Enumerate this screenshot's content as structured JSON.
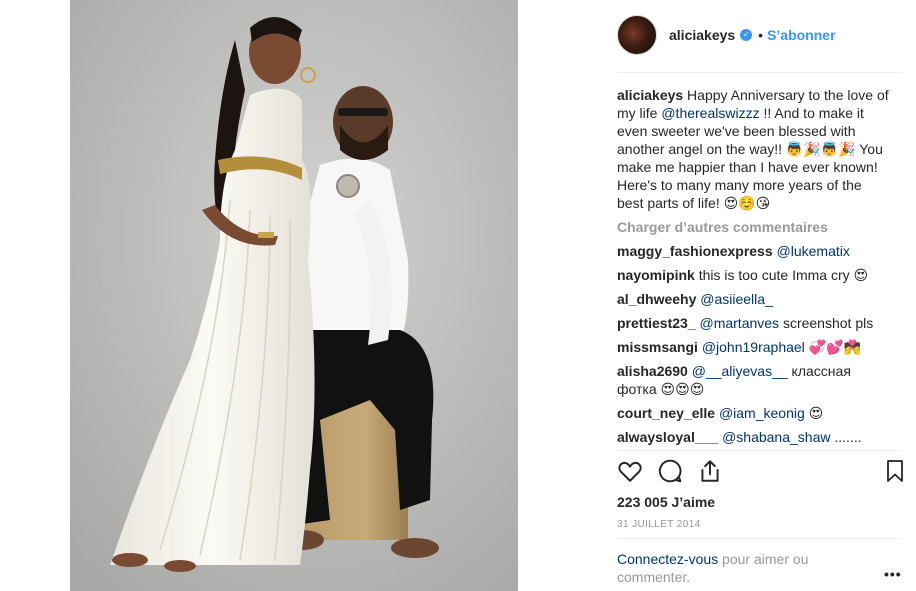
{
  "post": {
    "author": "aliciakeys",
    "follow_label": "S’abonner",
    "separator": "•",
    "verified_icon": "check-icon"
  },
  "caption": {
    "author": "aliciakeys",
    "text_1": " Happy Anniversary to the love of my life ",
    "mention": "@therealswizzz",
    "text_2": " !! And to make it even sweeter we've been blessed with another angel on the way!! 👼🎉👼🎉 You make me happier than I have ever known! Here's to many many more years of the best parts of life! 😍☺️😘"
  },
  "load_more_label": "Charger d’autres commentaires",
  "comments": [
    {
      "user": "maggy_fashionexpress",
      "mention": "@lukematix",
      "text": ""
    },
    {
      "user": "nayomipink",
      "mention": "",
      "text": "this is too cute Imma cry 😍"
    },
    {
      "user": "al_dhweehy",
      "mention": "@asiieella_",
      "text": ""
    },
    {
      "user": "prettiest23_",
      "mention": "@martanves",
      "text": " screenshot pls"
    },
    {
      "user": "missmsangi",
      "mention": "@john19raphael",
      "text": " 💞💕💏"
    },
    {
      "user": "alisha2690",
      "mention": "@__aliyevas__",
      "text": " классная фотка 😍😍😍"
    },
    {
      "user": "court_ney_elle",
      "mention": "@iam_keonig",
      "text": " 😍"
    },
    {
      "user": "alwaysloyal___",
      "mention": "@shabana_shaw",
      "text": " ......."
    }
  ],
  "stats": {
    "likes": "223 005 J’aime",
    "date": "31 JUILLET 2014"
  },
  "login_prompt": {
    "link": "Connectez-vous",
    "text": " pour aimer ou commenter."
  },
  "more_options": "•••",
  "icons": {
    "like": "heart-icon",
    "comment": "comment-icon",
    "share": "share-icon",
    "save": "bookmark-icon"
  },
  "colors": {
    "accent": "#3897f0",
    "link": "#003569",
    "muted": "#999999"
  }
}
